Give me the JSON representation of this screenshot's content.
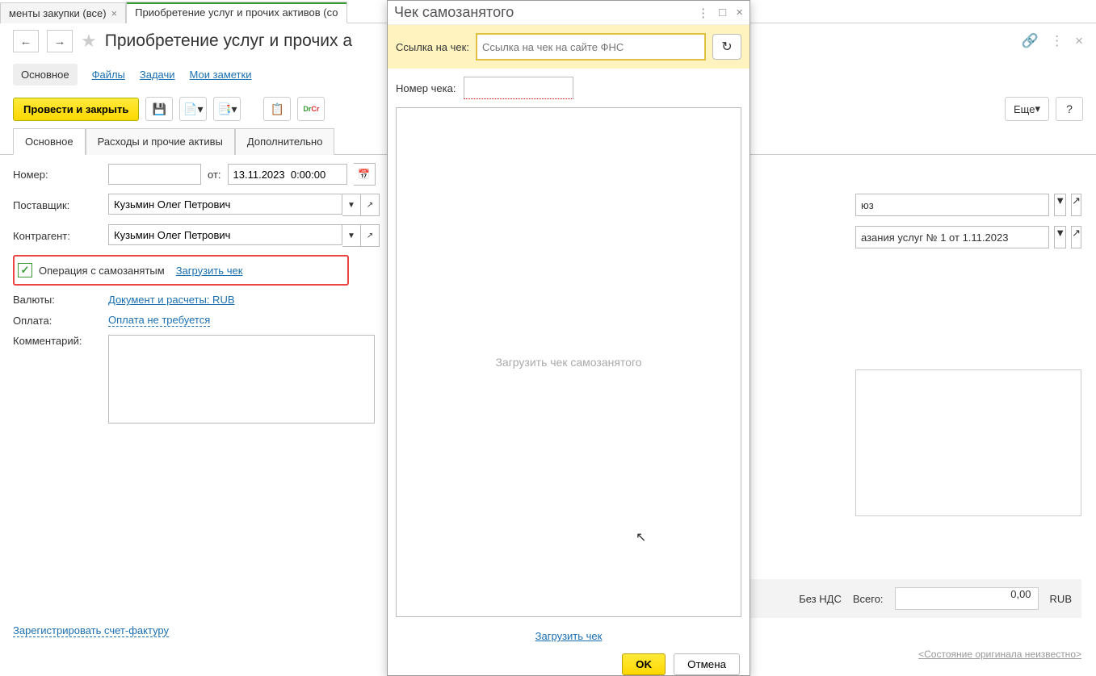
{
  "tabs": {
    "tab1": "менты закупки (все)",
    "tab2": "Приобретение услуг и прочих активов (со"
  },
  "header": {
    "title": "Приобретение услуг и прочих а"
  },
  "subnav": {
    "main": "Основное",
    "files": "Файлы",
    "tasks": "Задачи",
    "notes": "Мои заметки"
  },
  "toolbar": {
    "post_close": "Провести и закрыть",
    "more": "Еще",
    "help": "?"
  },
  "formTabs": {
    "main": "Основное",
    "expenses": "Расходы и прочие активы",
    "extra": "Дополнительно"
  },
  "form": {
    "number_lbl": "Номер:",
    "from_lbl": "от:",
    "date": "13.11.2023  0:00:00",
    "supplier_lbl": "Поставщик:",
    "supplier": "Кузьмин Олег Петрович",
    "contractor_lbl": "Контрагент:",
    "contractor": "Кузьмин Олег Петрович",
    "selfemp_lbl": "Операция с самозанятым",
    "load_check": "Загрузить чек",
    "currency_lbl": "Валюты:",
    "currency_link": "Документ и расчеты: RUB",
    "payment_lbl": "Оплата:",
    "payment_link": "Оплата не требуется",
    "comment_lbl": "Комментарий:"
  },
  "right": {
    "org_suffix": "юз",
    "contract": "азания услуг № 1 от 1.11.2023"
  },
  "footerArea": {
    "register": "Зарегистрировать счет-фактуру",
    "no_vat": "Без НДС",
    "total_lbl": "Всего:",
    "total_val": "0,00",
    "cur": "RUB",
    "orig": "<Состояние оригинала неизвестно>"
  },
  "dialog": {
    "title": "Чек самозанятого",
    "link_lbl": "Ссылка на чек:",
    "link_ph": "Ссылка на чек на сайте ФНС",
    "num_lbl": "Номер чека:",
    "placeholder": "Загрузить чек самозанятого",
    "load_link": "Загрузить чек",
    "ok": "OK",
    "cancel": "Отмена"
  }
}
